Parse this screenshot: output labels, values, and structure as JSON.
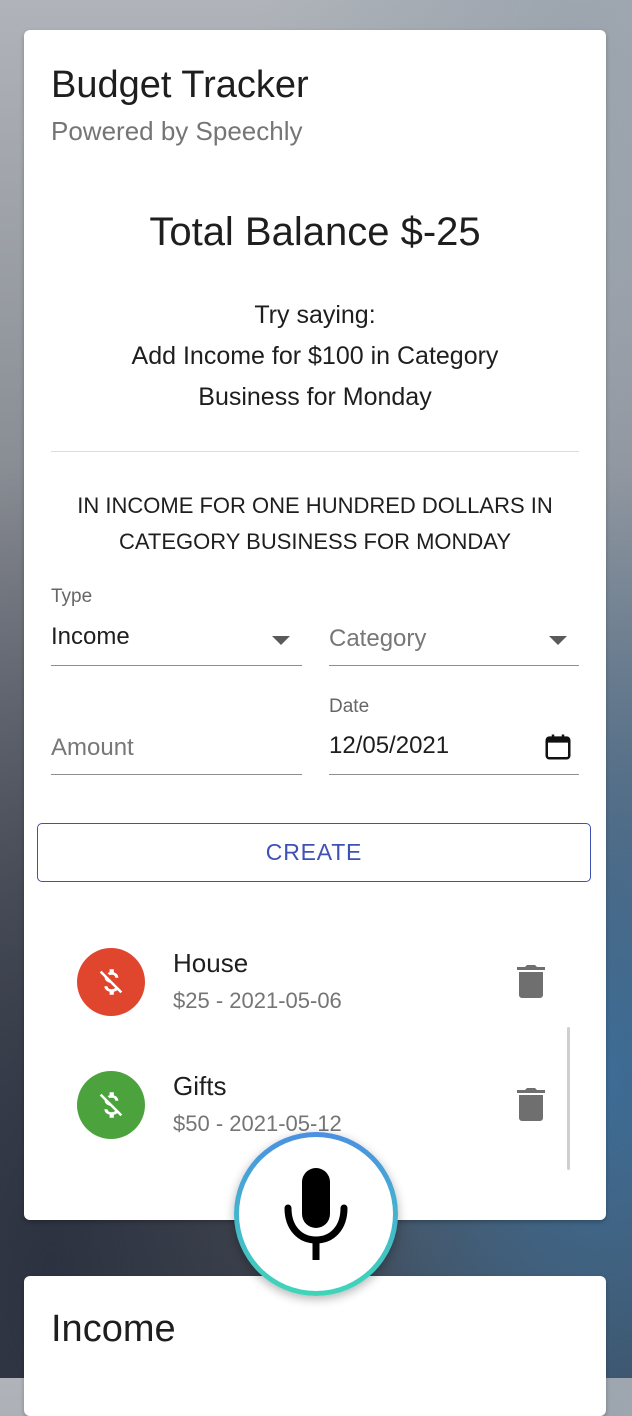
{
  "header": {
    "title": "Budget Tracker",
    "subtitle": "Powered by Speechly"
  },
  "balance": {
    "text": "Total Balance $-25"
  },
  "hint": {
    "line1": "Try saying:",
    "line2": "Add Income for $100 in Category",
    "line3": "Business for Monday"
  },
  "transcript": {
    "line1": "IN INCOME FOR ONE HUNDRED DOLLARS IN",
    "line2": "CATEGORY BUSINESS FOR MONDAY"
  },
  "form": {
    "type": {
      "label": "Type",
      "value": "Income"
    },
    "category": {
      "placeholder": "Category"
    },
    "amount": {
      "placeholder": "Amount"
    },
    "date": {
      "label": "Date",
      "value": "12/05/2021"
    },
    "create_label": "CREATE"
  },
  "transactions": [
    {
      "title": "House",
      "subtitle": "$25 - 2021-05-06",
      "kind": "expense",
      "color": "#e0452e"
    },
    {
      "title": "Gifts",
      "subtitle": "$50 - 2021-05-12",
      "kind": "income",
      "color": "#4ca23c"
    }
  ],
  "income_card": {
    "title": "Income"
  },
  "icons": {
    "avatar": "money-off-icon",
    "delete": "trash-icon",
    "date": "calendar-icon",
    "dropdown": "caret-down-icon",
    "voice": "microphone-icon"
  },
  "colors": {
    "primary": "#3f51b5",
    "expense": "#e0452e",
    "income": "#4ca23c",
    "mic_ring_top": "#4a90e2",
    "mic_ring_bottom": "#3fd6b8"
  }
}
